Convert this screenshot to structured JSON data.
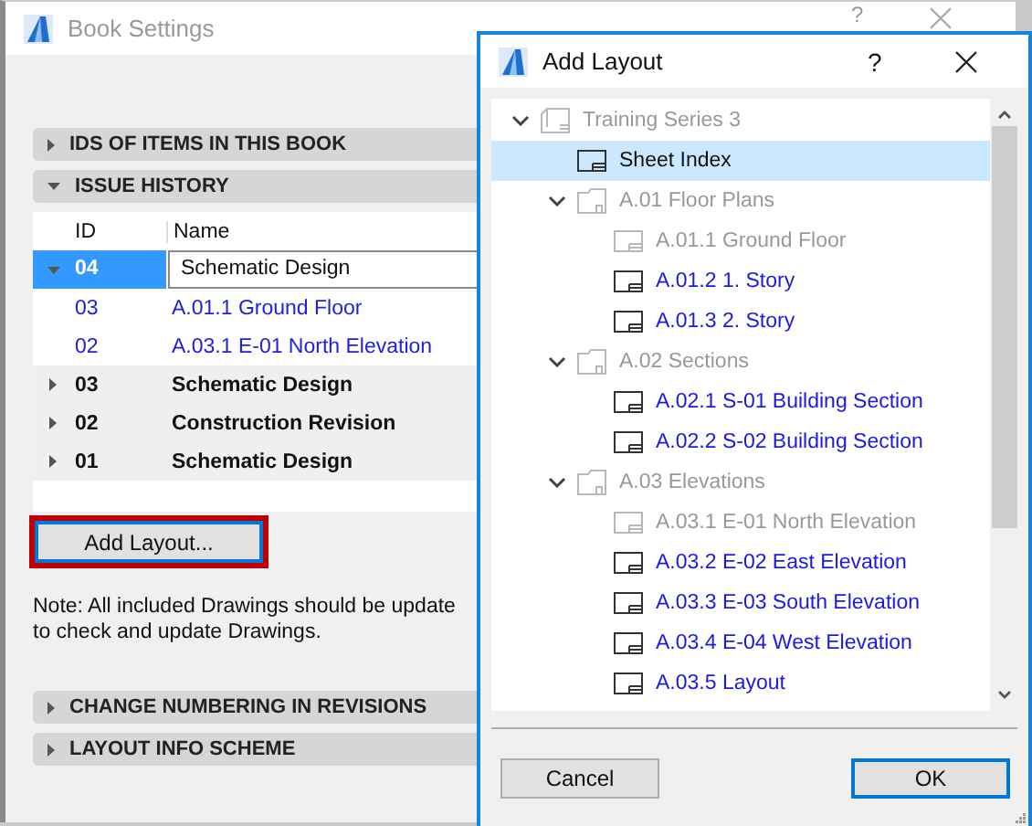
{
  "book_settings": {
    "title": "Book Settings",
    "help": "?",
    "sections_top": [
      {
        "label": "IDS OF ITEMS IN THIS BOOK",
        "expanded": false
      },
      {
        "label": "ISSUE HISTORY",
        "expanded": true
      }
    ],
    "issue_table": {
      "columns": [
        "ID",
        "Name"
      ],
      "rows": [
        {
          "id": "04",
          "name": "Schematic Design",
          "expanded": true,
          "selected": true,
          "children": [
            {
              "id": "03",
              "name": "A.01.1 Ground Floor"
            },
            {
              "id": "02",
              "name": "A.03.1 E-01 North Elevation"
            }
          ]
        },
        {
          "id": "03",
          "name": "Schematic Design",
          "expanded": false,
          "selected": false
        },
        {
          "id": "02",
          "name": "Construction Revision",
          "expanded": false,
          "selected": false
        },
        {
          "id": "01",
          "name": "Schematic Design",
          "expanded": false,
          "selected": false
        }
      ]
    },
    "add_button": {
      "label": "Add Layout...",
      "highlighted": true
    },
    "note": "Note: All included Drawings should be update\nto check and update Drawings.",
    "sections_bottom": [
      {
        "label": "CHANGE NUMBERING IN REVISIONS",
        "expanded": false
      },
      {
        "label": "LAYOUT INFO SCHEME",
        "expanded": false
      }
    ]
  },
  "add_layout": {
    "title": "Add Layout",
    "help": "?",
    "tree": [
      {
        "kind": "book",
        "label": "Training Series 3",
        "disabled": true,
        "expanded": true,
        "selected": false,
        "children": [
          {
            "kind": "layout",
            "label": "Sheet Index",
            "disabled": false,
            "selected": true
          },
          {
            "kind": "folder",
            "label": "A.01 Floor Plans",
            "disabled": true,
            "expanded": true,
            "selected": false,
            "children": [
              {
                "kind": "layout",
                "label": "A.01.1 Ground Floor",
                "disabled": true,
                "selected": false
              },
              {
                "kind": "layout",
                "label": "A.01.2 1. Story",
                "disabled": false,
                "selected": false
              },
              {
                "kind": "layout",
                "label": "A.01.3 2. Story",
                "disabled": false,
                "selected": false
              }
            ]
          },
          {
            "kind": "folder",
            "label": "A.02 Sections",
            "disabled": true,
            "expanded": true,
            "selected": false,
            "children": [
              {
                "kind": "layout",
                "label": "A.02.1 S-01 Building Section",
                "disabled": false,
                "selected": false
              },
              {
                "kind": "layout",
                "label": "A.02.2 S-02 Building Section",
                "disabled": false,
                "selected": false
              }
            ]
          },
          {
            "kind": "folder",
            "label": "A.03 Elevations",
            "disabled": true,
            "expanded": true,
            "selected": false,
            "children": [
              {
                "kind": "layout",
                "label": "A.03.1 E-01 North Elevation",
                "disabled": true,
                "selected": false
              },
              {
                "kind": "layout",
                "label": "A.03.2 E-02 East Elevation",
                "disabled": false,
                "selected": false
              },
              {
                "kind": "layout",
                "label": "A.03.3 E-03 South Elevation",
                "disabled": false,
                "selected": false
              },
              {
                "kind": "layout",
                "label": "A.03.4 E-04 West Elevation",
                "disabled": false,
                "selected": false
              },
              {
                "kind": "layout",
                "label": "A.03.5 Layout",
                "disabled": false,
                "selected": false
              }
            ]
          }
        ]
      }
    ],
    "buttons": [
      {
        "label": "Cancel",
        "default": false
      },
      {
        "label": "OK",
        "default": true
      }
    ]
  }
}
